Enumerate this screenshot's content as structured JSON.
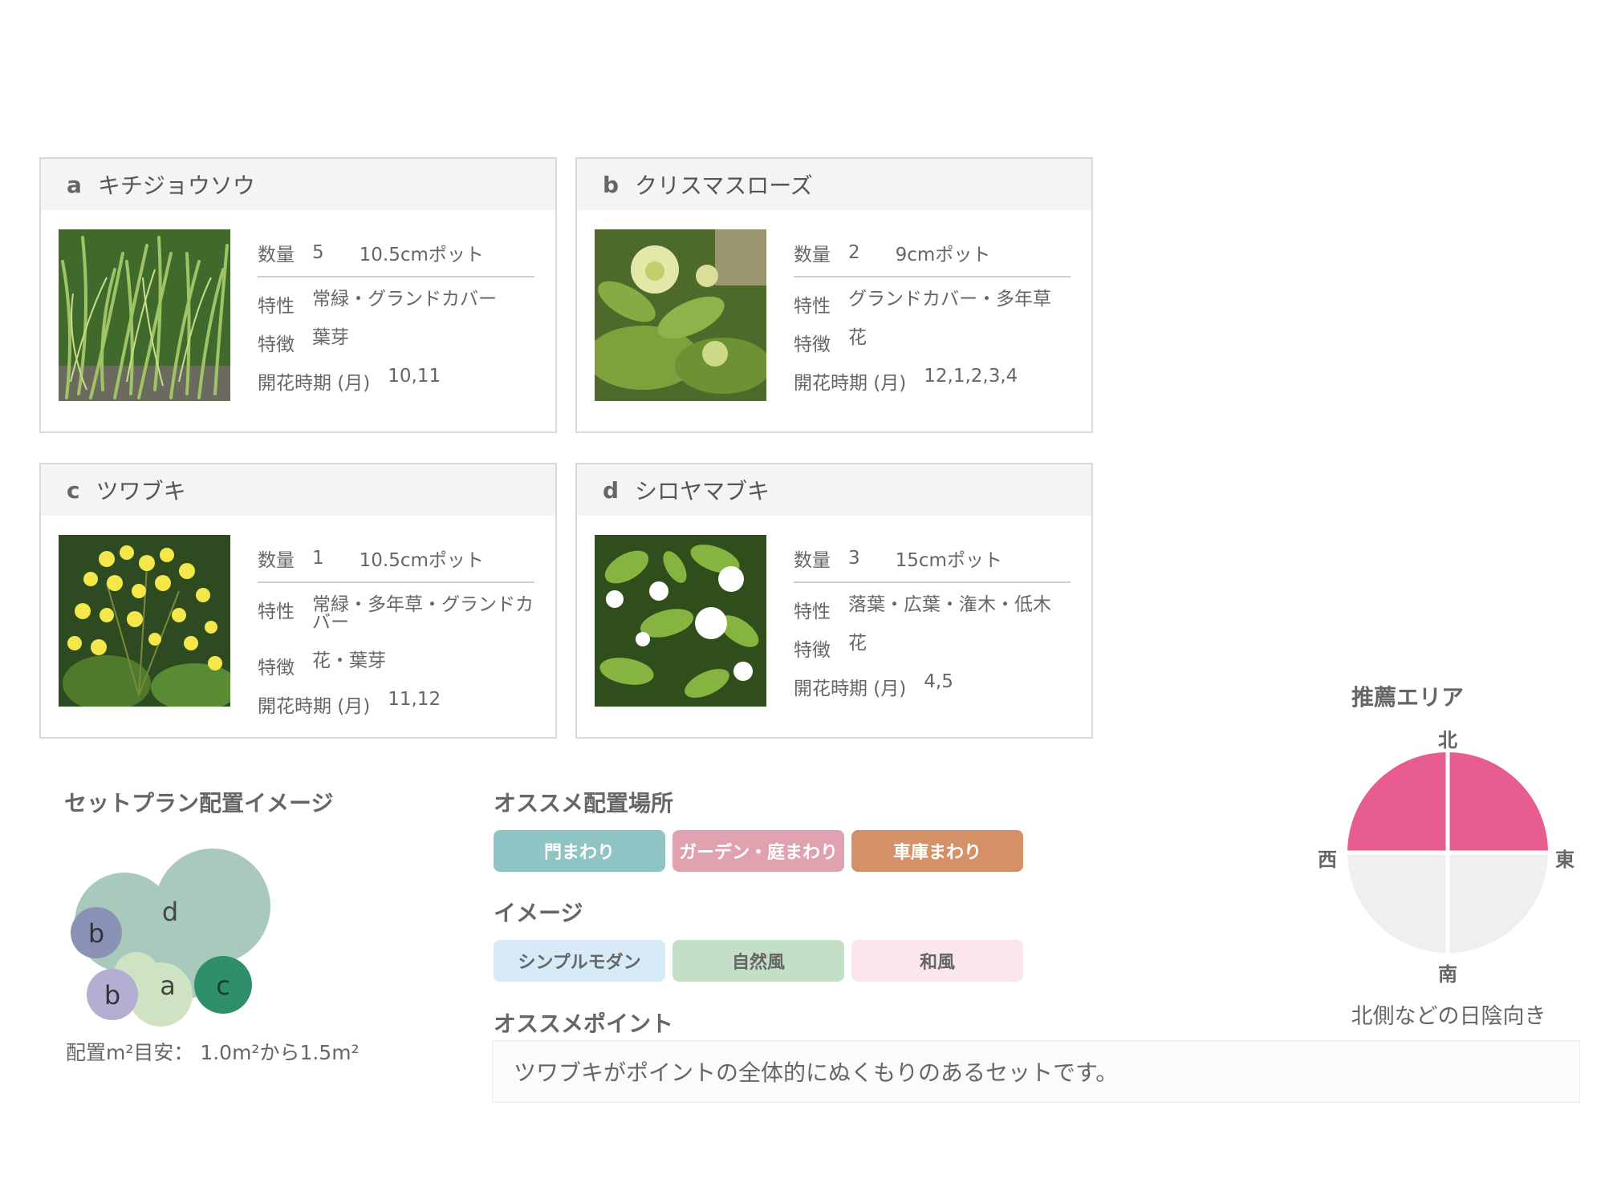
{
  "plants": [
    {
      "letter": "a",
      "name": "キチジョウソウ",
      "qty_label": "数量",
      "qty": "5",
      "pot": "10.5cmポット",
      "trait_label": "特性",
      "trait": "常緑・グランドカバー",
      "feature_label": "特徴",
      "feature": "葉芽",
      "bloom_label": "開花時期 (月)",
      "bloom": "10,11",
      "photo_icon": "grass-leaves-photo"
    },
    {
      "letter": "b",
      "name": "クリスマスローズ",
      "qty_label": "数量",
      "qty": "2",
      "pot": "9cmポット",
      "trait_label": "特性",
      "trait": "グランドカバー・多年草",
      "feature_label": "特徴",
      "feature": "花",
      "bloom_label": "開花時期 (月)",
      "bloom": "12,1,2,3,4",
      "photo_icon": "hellebore-flower-photo"
    },
    {
      "letter": "c",
      "name": "ツワブキ",
      "qty_label": "数量",
      "qty": "1",
      "pot": "10.5cmポット",
      "trait_label": "特性",
      "trait": "常緑・多年草・グランドカバー",
      "feature_label": "特徴",
      "feature": "花・葉芽",
      "bloom_label": "開花時期 (月)",
      "bloom": "11,12",
      "photo_icon": "yellow-flower-photo"
    },
    {
      "letter": "d",
      "name": "シロヤマブキ",
      "qty_label": "数量",
      "qty": "3",
      "pot": "15cmポット",
      "trait_label": "特性",
      "trait": "落葉・広葉・潅木・低木",
      "feature_label": "特徴",
      "feature": "花",
      "bloom_label": "開花時期 (月)",
      "bloom": "4,5",
      "photo_icon": "white-flower-photo"
    }
  ],
  "plan": {
    "title": "セットプラン配置イメージ",
    "caption": "配置m²目安： 1.0m²から1.5m²",
    "markers": [
      "d",
      "b",
      "b",
      "a",
      "c"
    ]
  },
  "placement": {
    "title": "オススメ配置場所",
    "tags": [
      {
        "label": "門まわり",
        "bg": "#8ec5c4",
        "fg": "#ffffff"
      },
      {
        "label": "ガーデン・庭まわり",
        "bg": "#e0a2ae",
        "fg": "#ffffff"
      },
      {
        "label": "車庫まわり",
        "bg": "#d49167",
        "fg": "#ffffff"
      }
    ]
  },
  "image_style": {
    "title": "イメージ",
    "tags": [
      {
        "label": "シンプルモダン",
        "bg": "#d6ebf7",
        "fg": "#666666"
      },
      {
        "label": "自然風",
        "bg": "#c3e0c6",
        "fg": "#666666"
      },
      {
        "label": "和風",
        "bg": "#fbe6ee",
        "fg": "#666666"
      }
    ]
  },
  "point": {
    "title": "オススメポイント",
    "text": "ツワブキがポイントの全体的にぬくもりのあるセットです。"
  },
  "area": {
    "title": "推薦エリア",
    "north": "北",
    "south": "南",
    "west": "西",
    "east": "東",
    "caption": "北側などの日陰向き",
    "active_color": "#e85d8f",
    "inactive_color": "#efefef"
  }
}
